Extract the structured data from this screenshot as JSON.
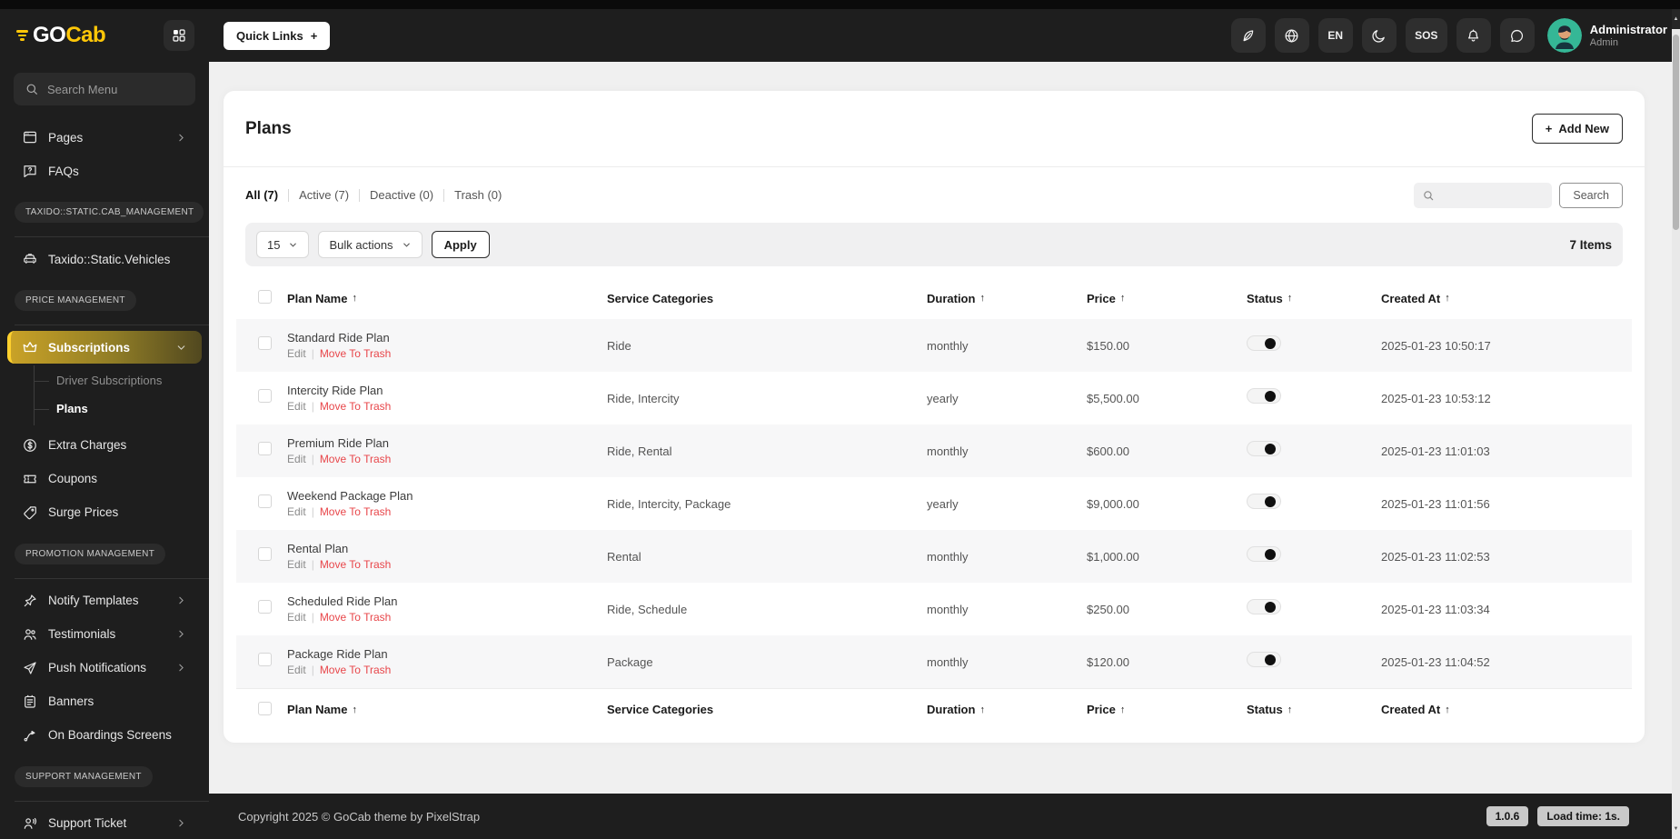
{
  "glyphs": {
    "plus": "+",
    "sort": "↑",
    "pipe": "|",
    "up_arrow": "▲",
    "down_arrow": "▼"
  },
  "brand": {
    "go": "GO",
    "cab": "Cab"
  },
  "topbar": {
    "quick_links_label": "Quick Links",
    "language": "EN",
    "sos": "SOS",
    "user": {
      "name": "Administrator",
      "role": "Admin"
    }
  },
  "sidebar": {
    "search_placeholder": "Search Menu",
    "items": [
      {
        "label": "Pages"
      },
      {
        "label": "FAQs"
      },
      {
        "label": "TAXIDO::STATIC.CAB_MANAGEMENT"
      },
      {
        "label": "Taxido::Static.Vehicles"
      },
      {
        "label": "PRICE MANAGEMENT"
      },
      {
        "label": "Subscriptions"
      },
      {
        "label": "Driver Subscriptions"
      },
      {
        "label": "Plans"
      },
      {
        "label": "Extra Charges"
      },
      {
        "label": "Coupons"
      },
      {
        "label": "Surge Prices"
      },
      {
        "label": "PROMOTION MANAGEMENT"
      },
      {
        "label": "Notify Templates"
      },
      {
        "label": "Testimonials"
      },
      {
        "label": "Push Notifications"
      },
      {
        "label": "Banners"
      },
      {
        "label": "On Boardings Screens"
      },
      {
        "label": "SUPPORT MANAGEMENT"
      },
      {
        "label": "Support Ticket"
      }
    ]
  },
  "page": {
    "title": "Plans",
    "add_new": "Add New",
    "tabs": [
      {
        "label": "All (7)"
      },
      {
        "label": "Active (7)"
      },
      {
        "label": "Deactive (0)"
      },
      {
        "label": "Trash (0)"
      }
    ],
    "search_button": "Search",
    "toolbar": {
      "per_page": "15",
      "bulk_actions": "Bulk actions",
      "apply": "Apply",
      "items_count": "7 Items"
    }
  },
  "table": {
    "headers": {
      "name": "Plan Name",
      "categories": "Service Categories",
      "duration": "Duration",
      "price": "Price",
      "status": "Status",
      "created": "Created At"
    },
    "actions": {
      "edit": "Edit",
      "trash": "Move To Trash"
    },
    "rows": [
      {
        "name": "Standard Ride Plan",
        "categories": "Ride",
        "duration": "monthly",
        "price": "$150.00",
        "status": "on",
        "created": "2025-01-23 10:50:17"
      },
      {
        "name": "Intercity Ride Plan",
        "categories": "Ride, Intercity",
        "duration": "yearly",
        "price": "$5,500.00",
        "status": "on",
        "created": "2025-01-23 10:53:12"
      },
      {
        "name": "Premium Ride Plan",
        "categories": "Ride, Rental",
        "duration": "monthly",
        "price": "$600.00",
        "status": "on",
        "created": "2025-01-23 11:01:03"
      },
      {
        "name": "Weekend Package Plan",
        "categories": "Ride, Intercity, Package",
        "duration": "yearly",
        "price": "$9,000.00",
        "status": "on",
        "created": "2025-01-23 11:01:56"
      },
      {
        "name": "Rental Plan",
        "categories": "Rental",
        "duration": "monthly",
        "price": "$1,000.00",
        "status": "on",
        "created": "2025-01-23 11:02:53"
      },
      {
        "name": "Scheduled Ride Plan",
        "categories": "Ride, Schedule",
        "duration": "monthly",
        "price": "$250.00",
        "status": "on",
        "created": "2025-01-23 11:03:34"
      },
      {
        "name": "Package Ride Plan",
        "categories": "Package",
        "duration": "monthly",
        "price": "$120.00",
        "status": "on",
        "created": "2025-01-23 11:04:52"
      }
    ]
  },
  "footer": {
    "copyright": "Copyright 2025 © GoCab theme by PixelStrap",
    "version": "1.0.6",
    "load_time": "Load time: 1s."
  },
  "colors": {
    "accent": "#ffc708",
    "danger": "#e8464a",
    "active_gradient": "#c9a227",
    "avatar_bg": "#35b796",
    "dark": "#1e1e1e"
  }
}
